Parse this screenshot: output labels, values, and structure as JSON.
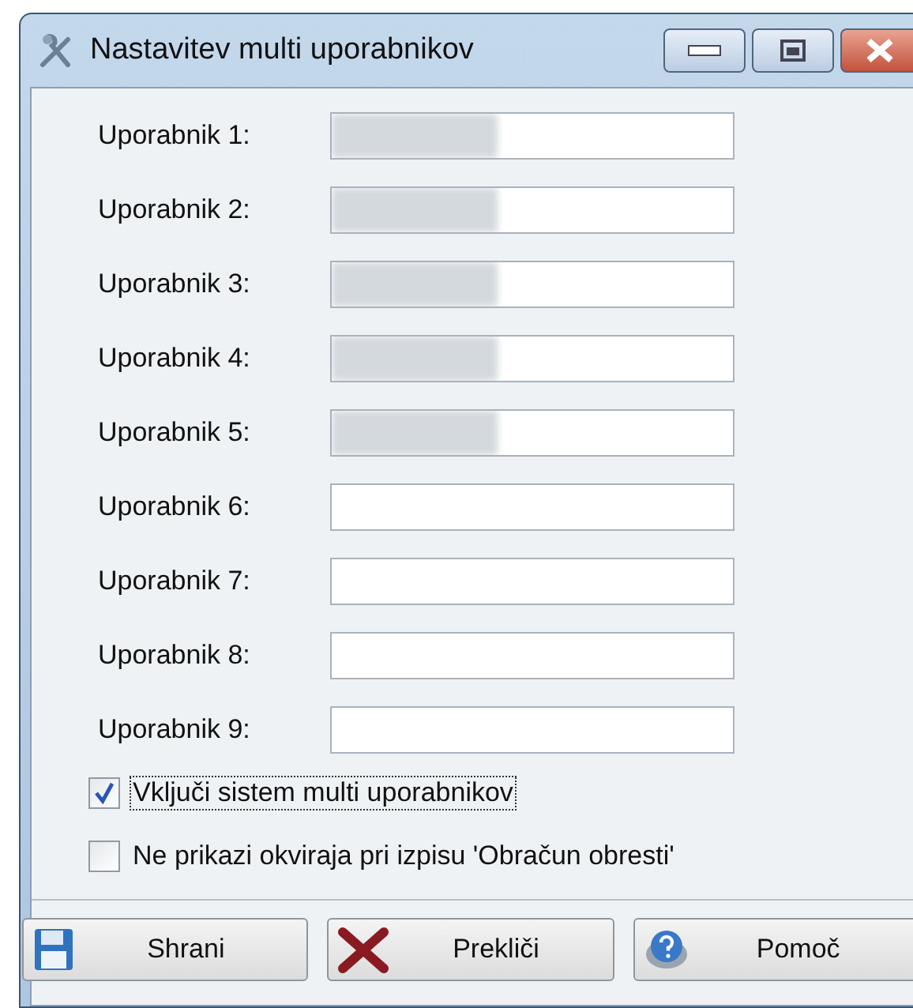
{
  "window": {
    "title": "Nastavitev multi uporabnikov"
  },
  "users": [
    {
      "label": "Uporabnik 1:",
      "redacted": true
    },
    {
      "label": "Uporabnik 2:",
      "redacted": true
    },
    {
      "label": "Uporabnik 3:",
      "redacted": true
    },
    {
      "label": "Uporabnik 4:",
      "redacted": true
    },
    {
      "label": "Uporabnik 5:",
      "redacted": true
    },
    {
      "label": "Uporabnik 6:",
      "redacted": false
    },
    {
      "label": "Uporabnik 7:",
      "redacted": false
    },
    {
      "label": "Uporabnik 8:",
      "redacted": false
    },
    {
      "label": "Uporabnik 9:",
      "redacted": false
    }
  ],
  "options": [
    {
      "label": "Vključi sistem multi uporabnikov",
      "checked": true,
      "focused": true
    },
    {
      "label": "Ne prikazi okviraja pri izpisu 'Obračun obresti'",
      "checked": false,
      "focused": false
    }
  ],
  "buttons": [
    {
      "kind": "save",
      "label": "Shrani"
    },
    {
      "kind": "cancel",
      "label": "Prekliči"
    },
    {
      "kind": "help",
      "label": "Pomoč"
    }
  ]
}
